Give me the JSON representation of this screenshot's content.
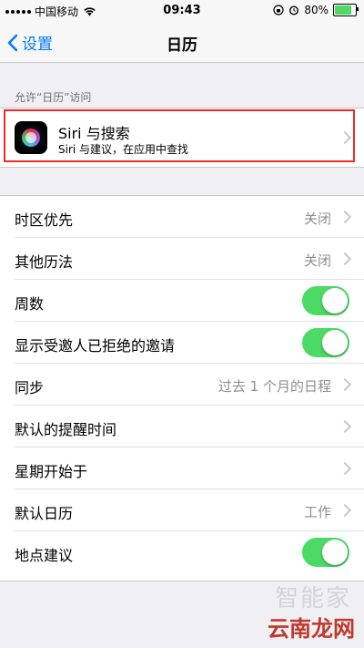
{
  "status": {
    "carrier": "中国移动",
    "time": "09:43",
    "battery": "80%",
    "battery_level": 0.8
  },
  "nav": {
    "back_label": "设置",
    "title": "日历"
  },
  "section_header": "允许“日历”访问",
  "siri": {
    "title": "Siri 与搜索",
    "subtitle": "Siri 与建议，在应用中查找"
  },
  "rows": [
    {
      "label": "时区优先",
      "value": "关闭"
    },
    {
      "label": "其他历法",
      "value": "关闭"
    },
    {
      "label": "周数",
      "toggle": true
    },
    {
      "label": "显示受邀人已拒绝的邀请",
      "toggle": true
    },
    {
      "label": "同步",
      "value": "过去 1 个月的日程"
    },
    {
      "label": "默认的提醒时间",
      "value": ""
    },
    {
      "label": "星期开始于",
      "value": ""
    },
    {
      "label": "默认日历",
      "value": "工作"
    },
    {
      "label": "地点建议",
      "toggle": true
    }
  ],
  "watermark_logo": "智能家",
  "watermark": "云南龙网",
  "colors": {
    "accent": "#007aff",
    "toggle_on": "#4cd964",
    "highlight": "#ee2b2b"
  }
}
